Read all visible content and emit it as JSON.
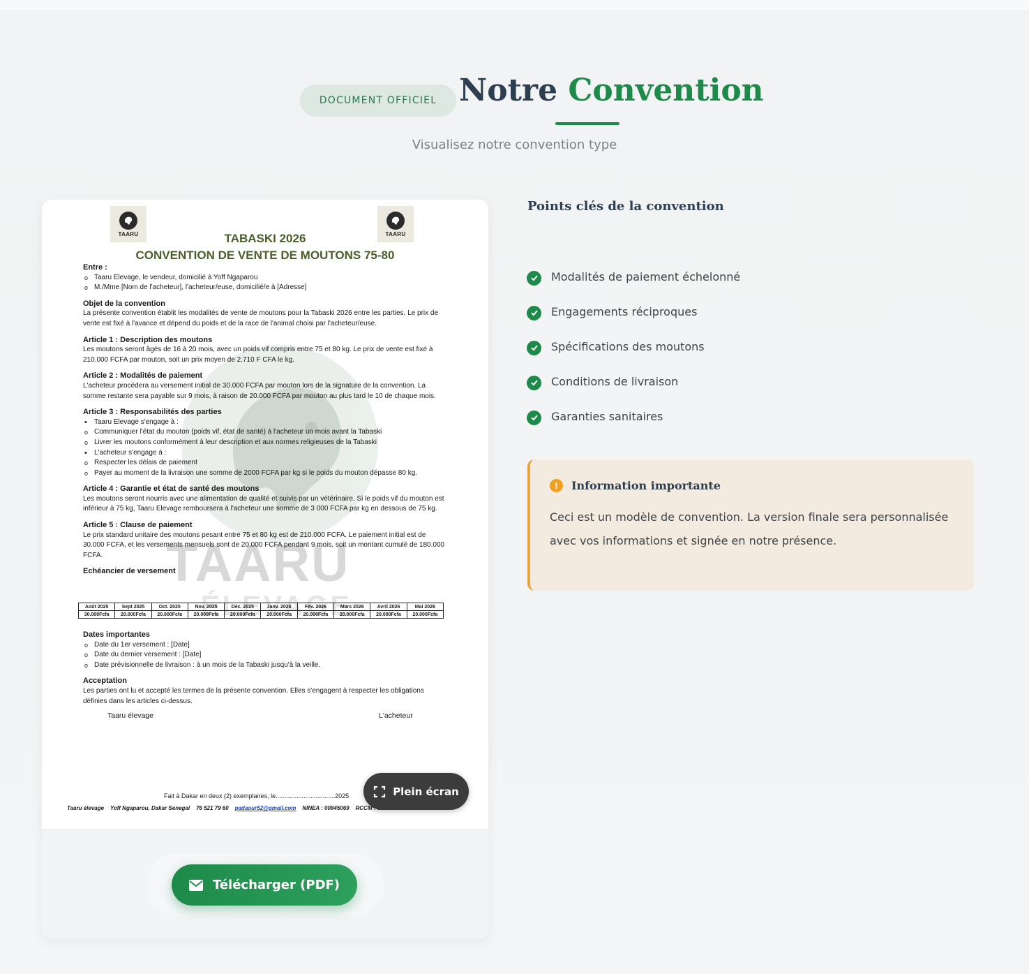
{
  "header": {
    "badge": "DOCUMENT OFFICIEL",
    "title_part1": "Notre ",
    "title_part2": "Convention",
    "subtitle": "Visualisez notre convention type"
  },
  "document": {
    "logo_text": "TAARU",
    "heading1": "TABASKI 2026",
    "heading2": "CONVENTION DE VENTE DE MOUTONS 75-80",
    "entre_h": "Entre :",
    "entre_1": "Taaru Elevage, le vendeur, domicilié à Yoff Ngaparou",
    "entre_2": "M./Mme [Nom de l'acheteur], l'acheteur/euse, domicilié/e à [Adresse]",
    "objet_h": "Objet de la convention",
    "objet_p": "La présente convention établit les modalités de vente de moutons pour la Tabaski 2026 entre les parties. Le prix de vente est fixé à l'avance et dépend du poids et de la race de l'animal choisi par l'acheteur/euse.",
    "a1_h": "Article 1 : Description des moutons",
    "a1_p": "Les moutons seront âgés de 16 à 20 mois, avec un poids vif compris entre 75 et 80 kg. Le prix de vente est fixé à 210.000 FCFA par mouton, soit un prix moyen de 2.710 F CFA le kg.",
    "a2_h": "Article 2 : Modalités de paiement",
    "a2_p": "L'acheteur procédera au versement initial de 30.000 FCFA par mouton lors de la signature de la convention. La somme restante sera payable sur 9 mois, à raison de 20.000 FCFA par mouton au plus tard le 10 de chaque mois.",
    "a3_h": "Article 3 : Responsabilités des parties",
    "a3_1": "Taaru Elevage s'engage à :",
    "a3_2": "Communiquer l'état du mouton (poids vif, état de santé) à l'acheteur un mois avant la Tabaski",
    "a3_3": "Livrer les moutons conformément à leur description et aux normes religieuses de la Tabaski",
    "a3_4": "L'acheteur s'engage à :",
    "a3_5": "Respecter les délais de paiement",
    "a3_6": "Payer au moment de la livraison une somme de 2000 FCFA par kg si le poids du mouton dépasse 80 kg.",
    "a4_h": "Article 4 : Garantie et état de santé des moutons",
    "a4_p": "Les moutons seront nourris avec une alimentation de qualité et suivis par un vétérinaire. Si le poids vif du mouton est inférieur à 75 kg, Taaru Elevage remboursera à l'acheteur une somme de 3 000 FCFA par kg en dessous de 75 kg.",
    "a5_h": "Article 5 : Clause de paiement",
    "a5_p": "Le prix standard unitaire des moutons pesant entre 75 et 80 kg est de 210.000 FCFA. Le paiement initial est de 30.000 FCFA, et les versements mensuels sont de 20.000 FCFA pendant 9 mois, soit un montant cumulé de 180.000 FCFA.",
    "sched_h": "Echéancier de versement",
    "schedule_months": [
      "Août 2025",
      "Sept 2025",
      "Oct. 2025",
      "Nov. 2025",
      "Déc. 2025",
      "Janv. 2026",
      "Fév. 2026",
      "Mars 2026",
      "Avril 2026",
      "Mai 2026"
    ],
    "schedule_amounts": [
      "30.000Fcfa",
      "20.000Fcfa",
      "20.000Fcfa",
      "20.000Fcfa",
      "20.000Fcfa",
      "20.000Fcfa",
      "20.000Fcfa",
      "20.000Fcfa",
      "20.000Fcfa",
      "20.000Fcfa"
    ],
    "dates_h": "Dates importantes",
    "dates_1": "Date du 1er versement : [Date]",
    "dates_2": "Date du dernier versement : [Date]",
    "dates_3": "Date prévisionnelle de livraison : à un mois de la Tabaski jusqu'à la veille.",
    "acc_h": "Acceptation",
    "acc_p": "Les parties ont lu et accepté les termes de la présente convention. Elles s'engagent à respecter les obligations définies dans les articles ci-dessus.",
    "sig_left": "Taaru élevage",
    "sig_right": "L'acheteur",
    "fait": "Fait à Dakar en deux (2) exemplaires, le..................................2025",
    "footer_name": "Taaru élevage",
    "footer_addr": "Yoff Ngaparou, Dakar Senegal",
    "footer_phone": "76 521 79 60",
    "footer_email": "padaour52@gmail.com",
    "footer_ninea": "NINEA : 00845069",
    "footer_rccm": "RCCM : SN.DKR.2020.A14219",
    "watermark_1": "TAARU",
    "watermark_2": "ÉLEVAGE"
  },
  "buttons": {
    "fullscreen": "Plein écran",
    "download": "Télécharger (PDF)"
  },
  "key_points": {
    "title": "Points clés de la convention",
    "items": [
      "Modalités de paiement échelonné",
      "Engagements réciproques",
      "Spécifications des moutons",
      "Conditions de livraison",
      "Garanties sanitaires"
    ]
  },
  "info": {
    "title": "Information importante",
    "text": "Ceci est un modèle de convention. La version finale sera personnalisée avec vos informations et signée en notre présence."
  },
  "colors": {
    "brand_green": "#1e8a4a",
    "warning_orange": "#e8a53a",
    "info_bg": "#f3ebe0"
  }
}
